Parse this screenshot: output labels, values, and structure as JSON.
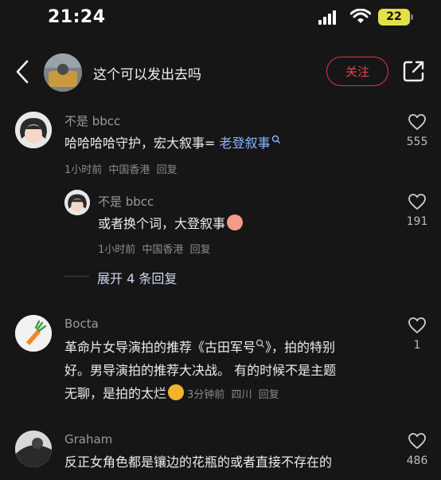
{
  "status_bar": {
    "time": "21:24",
    "battery": "22"
  },
  "header": {
    "title": "这个可以发出去吗",
    "follow_label": "关注"
  },
  "comments": [
    {
      "name": "不是 bbcc",
      "text_plain": "哈哈哈哈守护，宏大叙事= ",
      "text_link": "老登叙事",
      "time": "1小时前",
      "location": "中国香港",
      "reply": "回复",
      "likes": "555"
    },
    {
      "name": "不是 bbcc",
      "text": "或者换个词，大登叙事",
      "time": "1小时前",
      "location": "中国香港",
      "reply": "回复",
      "likes": "191"
    },
    {
      "name": "Bocta",
      "line1_a": "革命片女导演拍的推荐《",
      "line1_link": "古田军号",
      "line1_b": "》，拍的特别",
      "line2": "好。男导演拍的推荐大决战。  有的时候不是主题",
      "line3": "无聊，是拍的太烂",
      "time": "3分钟前",
      "location": "四川",
      "reply": "回复",
      "likes": "1"
    },
    {
      "name": "Graham",
      "text": "反正女角色都是镶边的花瓶的或者直接不存在的",
      "likes": "486"
    }
  ],
  "expand_replies": "展开 4 条回复"
}
